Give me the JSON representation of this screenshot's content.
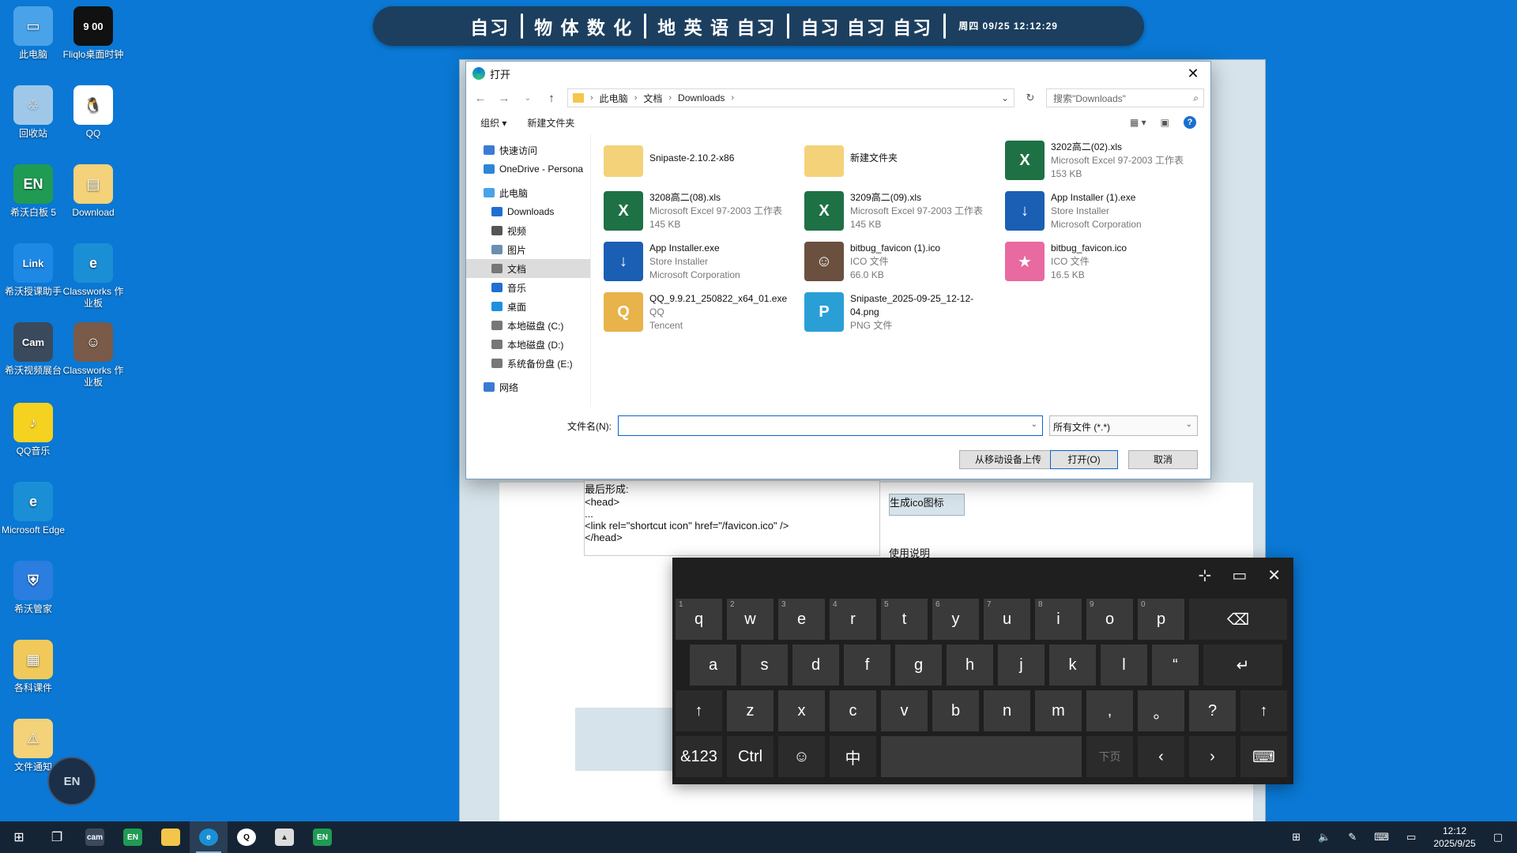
{
  "desktop": {
    "icons": [
      {
        "label": "此电脑",
        "color": "#4aa3e8",
        "glyph": "▭"
      },
      {
        "label": "Fliqlo桌面时钟",
        "color": "#111111",
        "glyph": "9 00"
      },
      {
        "label": "回收站",
        "color": "#9fc8e8",
        "glyph": "♲"
      },
      {
        "label": "QQ",
        "color": "#ffffff",
        "glyph": "🐧"
      },
      {
        "label": "希沃白板 5",
        "color": "#1f9b53",
        "glyph": "EN"
      },
      {
        "label": "Download",
        "color": "#f3d27a",
        "glyph": "▤"
      },
      {
        "label": "希沃授课助手",
        "color": "#1e88e5",
        "glyph": "Link"
      },
      {
        "label": "Classworks 作业板",
        "color": "#1a8fd6",
        "glyph": "e"
      },
      {
        "label": "希沃视频展台",
        "color": "#3a4a5c",
        "glyph": "Cam"
      },
      {
        "label": "Classworks 作业板",
        "color": "#7a5a48",
        "glyph": "☺"
      },
      {
        "label": "QQ音乐",
        "color": "#f4d21f",
        "glyph": "♪"
      },
      {
        "label": "Microsoft Edge",
        "color": "#1a8fd6",
        "glyph": "e"
      },
      {
        "label": "希沃管家",
        "color": "#2b7de0",
        "glyph": "⛨"
      },
      {
        "label": "各科课件",
        "color": "#f0c95a",
        "glyph": "▦"
      },
      {
        "label": "文件通知",
        "color": "#f3d27a",
        "glyph": "⚠"
      }
    ]
  },
  "topbar": {
    "segments": [
      "自习",
      "物 体 数 化",
      "地 英 语 自习",
      "自习 自习 自习"
    ],
    "datetime": "周四 09/25  12:12:29"
  },
  "background_page": {
    "code_lines": [
      "最后形成:",
      "<head>",
      "...",
      "<link rel=\"shortcut icon\" href=\"/favicon.ico\" />",
      "</head>"
    ],
    "generate_button": "生成ico图标",
    "usage_heading": "使用说明"
  },
  "dialog": {
    "title": "打开",
    "breadcrumb": [
      "此电脑",
      "文档",
      "Downloads"
    ],
    "search_placeholder": "搜索\"Downloads\"",
    "toolbar": {
      "organize": "组织 ▾",
      "new_folder": "新建文件夹",
      "help": "?"
    },
    "tree": [
      {
        "label": "快速访问",
        "color": "#3b7bd4",
        "indent": 0
      },
      {
        "label": "OneDrive - Persona",
        "color": "#2d86d8",
        "indent": 0
      },
      {
        "label": "此电脑",
        "color": "#4aa3e8",
        "indent": 0
      },
      {
        "label": "Downloads",
        "color": "#1f6fd0",
        "indent": 1
      },
      {
        "label": "视频",
        "color": "#555555",
        "indent": 1
      },
      {
        "label": "图片",
        "color": "#6b8fb0",
        "indent": 1
      },
      {
        "label": "文档",
        "color": "#777777",
        "indent": 1,
        "selected": true
      },
      {
        "label": "音乐",
        "color": "#1f6fd0",
        "indent": 1
      },
      {
        "label": "桌面",
        "color": "#1f8fe0",
        "indent": 1
      },
      {
        "label": "本地磁盘 (C:)",
        "color": "#777777",
        "indent": 1
      },
      {
        "label": "本地磁盘 (D:)",
        "color": "#777777",
        "indent": 1
      },
      {
        "label": "系统备份盘 (E:)",
        "color": "#777777",
        "indent": 1
      },
      {
        "label": "网络",
        "color": "#3b7bd4",
        "indent": 0
      }
    ],
    "files": [
      {
        "name": "Snipaste-2.10.2-x86",
        "line2": "",
        "line3": "",
        "icon": "folder",
        "color": "#f3d27a"
      },
      {
        "name": "新建文件夹",
        "line2": "",
        "line3": "",
        "icon": "folder",
        "color": "#f3d27a"
      },
      {
        "name": "3202高二(02).xls",
        "line2": "Microsoft Excel 97-2003 工作表",
        "line3": "153 KB",
        "icon": "excel",
        "color": "#1e7145"
      },
      {
        "name": "3208高二(08).xls",
        "line2": "Microsoft Excel 97-2003 工作表",
        "line3": "145 KB",
        "icon": "excel",
        "color": "#1e7145"
      },
      {
        "name": "3209高二(09).xls",
        "line2": "Microsoft Excel 97-2003 工作表",
        "line3": "145 KB",
        "icon": "excel",
        "color": "#1e7145"
      },
      {
        "name": "App Installer (1).exe",
        "line2": "Store Installer",
        "line3": "Microsoft Corporation",
        "icon": "installer",
        "color": "#1a5fb4"
      },
      {
        "name": "App Installer.exe",
        "line2": "Store Installer",
        "line3": "Microsoft Corporation",
        "icon": "installer",
        "color": "#1a5fb4"
      },
      {
        "name": "bitbug_favicon (1).ico",
        "line2": "ICO 文件",
        "line3": "66.0 KB",
        "icon": "photo",
        "color": "#6b5040"
      },
      {
        "name": "bitbug_favicon.ico",
        "line2": "ICO 文件",
        "line3": "16.5 KB",
        "icon": "anime",
        "color": "#e86aa0"
      },
      {
        "name": "QQ_9.9.21_250822_x64_01.exe",
        "line2": "QQ",
        "line3": "Tencent",
        "icon": "qq",
        "color": "#e7b34a"
      },
      {
        "name": "Snipaste_2025-09-25_12-12-04.png",
        "line2": "PNG 文件",
        "line3": "",
        "icon": "png",
        "color": "#2a9fd6"
      }
    ],
    "filename_label": "文件名(N):",
    "filename_value": "",
    "filetype": "所有文件 (*.*)",
    "upload_button": "从移动设备上传",
    "open_button": "打开(O)",
    "cancel_button": "取消"
  },
  "keyboard": {
    "row1": [
      {
        "k": "q",
        "n": "1"
      },
      {
        "k": "w",
        "n": "2"
      },
      {
        "k": "e",
        "n": "3"
      },
      {
        "k": "r",
        "n": "4"
      },
      {
        "k": "t",
        "n": "5"
      },
      {
        "k": "y",
        "n": "6"
      },
      {
        "k": "u",
        "n": "7"
      },
      {
        "k": "i",
        "n": "8"
      },
      {
        "k": "o",
        "n": "9"
      },
      {
        "k": "p",
        "n": "0"
      }
    ],
    "row2": [
      "a",
      "s",
      "d",
      "f",
      "g",
      "h",
      "j",
      "k",
      "l",
      "“"
    ],
    "row3": [
      "z",
      "x",
      "c",
      "v",
      "b",
      "n",
      "m",
      ",",
      "。",
      "?"
    ],
    "backspace": "⌫",
    "enter": "↵",
    "shift": "↑",
    "sym": "&123",
    "ctrl": "Ctrl",
    "emoji": "☺",
    "lang": "中",
    "pagedown": "下页",
    "left": "‹",
    "right": "›",
    "kbd": "⌨"
  },
  "taskbar": {
    "time": "12:12",
    "date": "2025/9/25"
  },
  "floating_button": "EN"
}
